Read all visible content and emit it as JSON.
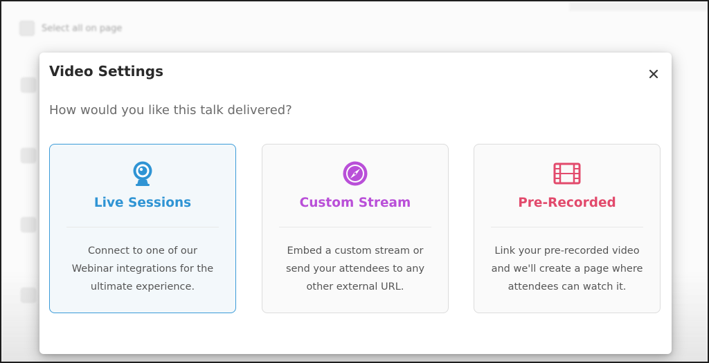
{
  "background": {
    "select_all_label": "Select all on page"
  },
  "modal": {
    "title": "Video Settings",
    "question": "How would you like this talk delivered?",
    "close_icon": "close-icon",
    "options": [
      {
        "title": "Live Sessions",
        "icon": "webcam-icon",
        "color": "#2f94d4",
        "selected": true,
        "description_lines": [
          "Connect to one of our",
          "Webinar integrations for the",
          "ultimate experience."
        ]
      },
      {
        "title": "Custom Stream",
        "icon": "compass-icon",
        "color": "#b94fd8",
        "selected": false,
        "description_lines": [
          "Embed a custom stream or",
          "send your attendees to any",
          "other external URL."
        ]
      },
      {
        "title": "Pre-Recorded",
        "icon": "film-icon",
        "color": "#e24a6c",
        "selected": false,
        "description_lines": [
          "Link your pre-recorded video",
          "and we'll create a page where",
          "attendees can watch it."
        ]
      }
    ]
  }
}
